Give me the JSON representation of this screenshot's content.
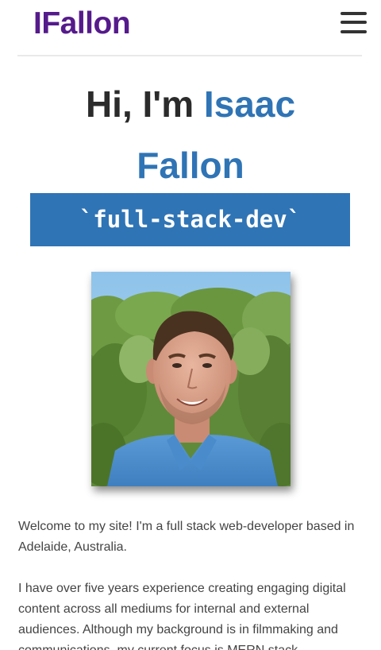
{
  "nav": {
    "brand": "IFallon",
    "menu_icon": "hamburger-menu-icon"
  },
  "hero": {
    "greeting": "Hi, I'm ",
    "first_name": "Isaac",
    "last_name": "Fallon",
    "role": "`full-stack-dev`"
  },
  "portrait": {
    "icon": "profile-photo"
  },
  "intro": {
    "paragraph_1": "Welcome to my site! I'm a full stack web-developer based in Adelaide, Australia.",
    "paragraph_2": "I have over five years experience creating engaging digital content across all mediums for internal and external audiences. Although my background is in filmmaking and communications, my current focus is MERN stack"
  },
  "colors": {
    "brand": "#551a8b",
    "accent": "#2f74b5",
    "text": "#2b2b2b"
  }
}
